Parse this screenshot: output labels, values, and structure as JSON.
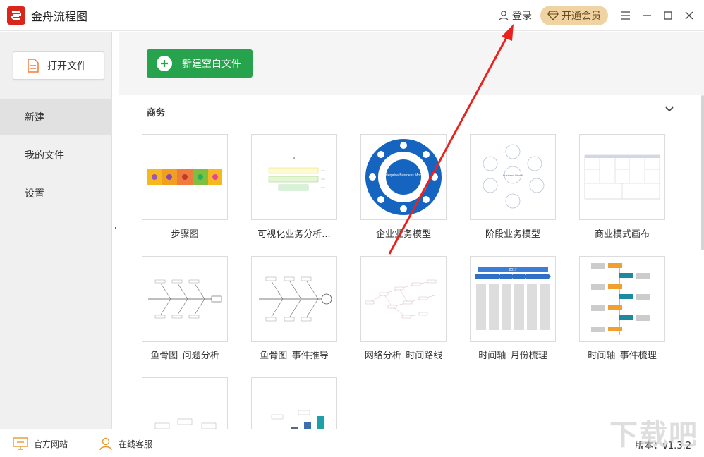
{
  "app": {
    "title": "金舟流程图"
  },
  "titlebar": {
    "login_label": "登录",
    "vip_label": "开通会员"
  },
  "sidebar": {
    "open_file_label": "打开文件",
    "items": [
      {
        "label": "新建",
        "active": true
      },
      {
        "label": "我的文件",
        "active": false
      },
      {
        "label": "设置",
        "active": false
      }
    ],
    "collapse_glyph": "\""
  },
  "main": {
    "new_blank_label": "新建空白文件",
    "section_title": "商务",
    "templates": [
      {
        "label": "步骤图",
        "thumb": "steps"
      },
      {
        "label": "可视化业务分析...",
        "thumb": "visual-analysis"
      },
      {
        "label": "企业业务模型",
        "thumb": "enterprise-model"
      },
      {
        "label": "阶段业务模型",
        "thumb": "stage-model"
      },
      {
        "label": "商业模式画布",
        "thumb": "canvas"
      },
      {
        "label": "鱼骨图_问题分析",
        "thumb": "fishbone-1"
      },
      {
        "label": "鱼骨图_事件推导",
        "thumb": "fishbone-2"
      },
      {
        "label": "网络分析_时间路线",
        "thumb": "network"
      },
      {
        "label": "时间轴_月份梳理",
        "thumb": "timeline-month"
      },
      {
        "label": "时间轴_事件梳理",
        "thumb": "timeline-event"
      },
      {
        "label": "",
        "thumb": "flow-partial"
      },
      {
        "label": "",
        "thumb": "bar3d-partial"
      }
    ],
    "thumb_texts": {
      "enterprise_center": "Enterprise Business Model",
      "stage_center": "Business Model",
      "timeline_year": "2017"
    }
  },
  "statusbar": {
    "website_label": "官方网站",
    "support_label": "在线客服",
    "version_label": "版本：v1.3.2"
  },
  "watermark": "下载吧",
  "colors": {
    "brand_red": "#d9261c",
    "green": "#26a34c",
    "vip_gold": "#f0d3a3",
    "arrow_red": "#e8231f",
    "enterprise_blue": "#1565c0"
  }
}
